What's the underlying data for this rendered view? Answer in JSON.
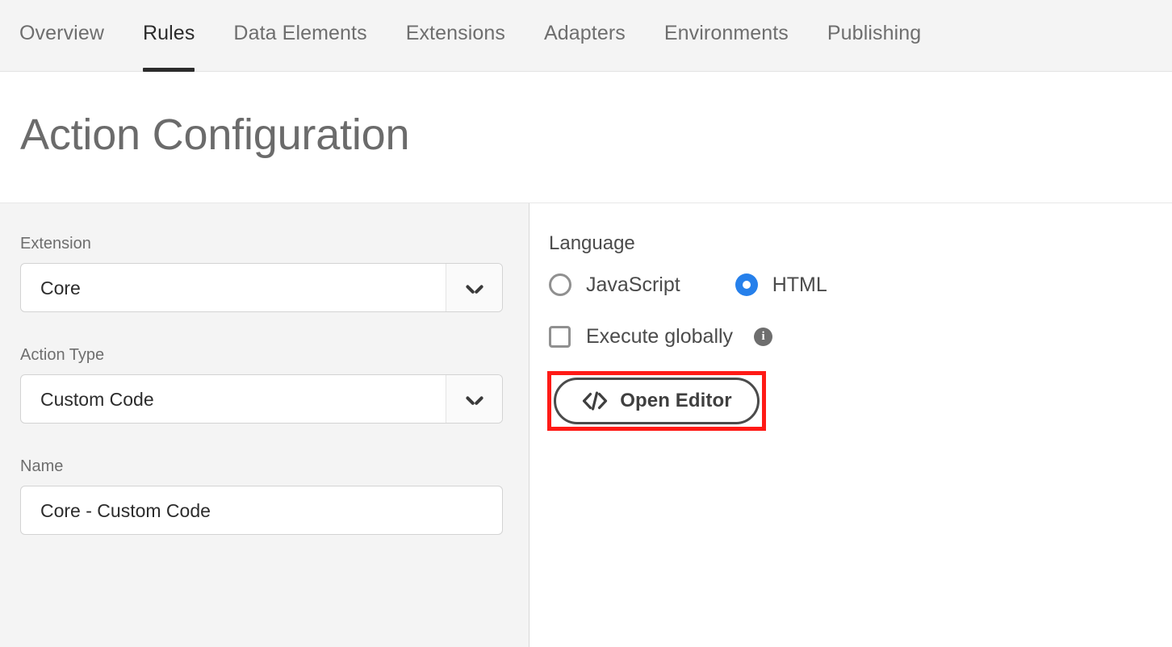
{
  "header": {
    "tabs": [
      {
        "label": "Overview",
        "active": false
      },
      {
        "label": "Rules",
        "active": true
      },
      {
        "label": "Data Elements",
        "active": false
      },
      {
        "label": "Extensions",
        "active": false
      },
      {
        "label": "Adapters",
        "active": false
      },
      {
        "label": "Environments",
        "active": false
      },
      {
        "label": "Publishing",
        "active": false
      }
    ]
  },
  "page": {
    "title": "Action Configuration"
  },
  "left_panel": {
    "extension": {
      "label": "Extension",
      "value": "Core",
      "control": "dropdown",
      "icon": "chevron-down-icon"
    },
    "action_type": {
      "label": "Action Type",
      "value": "Custom Code",
      "control": "dropdown",
      "icon": "chevron-down-icon"
    },
    "name": {
      "label": "Name",
      "value": "Core - Custom Code",
      "placeholder": "Name",
      "control": "text"
    }
  },
  "right_panel": {
    "language": {
      "label": "Language",
      "options": [
        {
          "label": "JavaScript",
          "selected": false
        },
        {
          "label": "HTML",
          "selected": true
        }
      ],
      "selected_color": "#2680eb"
    },
    "execute_globally": {
      "label": "Execute globally",
      "checked": false,
      "info_icon": "info-icon",
      "info_glyph": "i"
    },
    "open_editor": {
      "label": "Open Editor",
      "icon": "code-icon"
    },
    "highlight": {
      "name": "red-highlight-box",
      "color": "#ff1a16"
    }
  }
}
